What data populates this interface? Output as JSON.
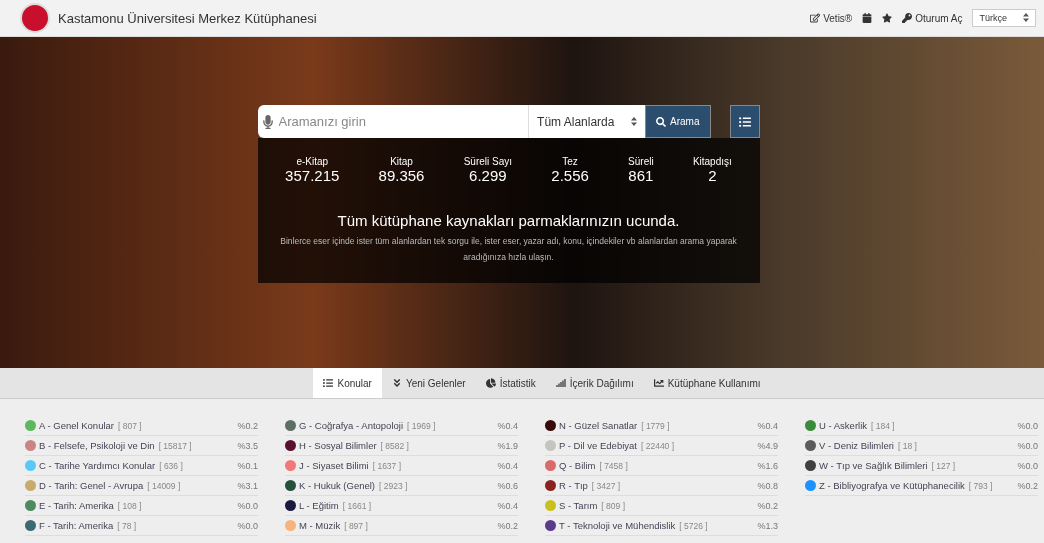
{
  "header": {
    "title": "Kastamonu Üniversitesi Merkez Kütüphanesi",
    "vetis": "Vetis®",
    "login": "Oturum Aç",
    "language": "Türkçe"
  },
  "search": {
    "placeholder": "Aramanızı girin",
    "scope": "Tüm Alanlarda",
    "button": "Arama"
  },
  "stats": [
    {
      "label": "e-Kitap",
      "value": "357.215"
    },
    {
      "label": "Kitap",
      "value": "89.356"
    },
    {
      "label": "Süreli Sayı",
      "value": "6.299"
    },
    {
      "label": "Tez",
      "value": "2.556"
    },
    {
      "label": "Süreli",
      "value": "861"
    },
    {
      "label": "Kitapdışı",
      "value": "2"
    }
  ],
  "headline": "Tüm kütüphane kaynakları parmaklarınızın ucunda.",
  "description": "Binlerce eser içinde ister tüm alanlardan tek sorgu ile, ister eser, yazar adı, konu, içindekiler vb alanlardan arama yaparak aradığınıza hızla ulaşın.",
  "tabs": [
    {
      "kind": "list",
      "label": "Konular",
      "selected": true
    },
    {
      "kind": "chevrons",
      "label": "Yeni Gelenler",
      "selected": false
    },
    {
      "kind": "pie",
      "label": "İstatistik",
      "selected": false
    },
    {
      "kind": "bars",
      "label": "İçerik Dağılımı",
      "selected": false
    },
    {
      "kind": "line",
      "label": "Kütüphane Kullanımı",
      "selected": false
    }
  ],
  "subject_columns": [
    [
      {
        "name": "A - Genel Konular",
        "count": "[ 807 ]",
        "percent": "%0.2",
        "color": "#5cb85c"
      },
      {
        "name": "B - Felsefe, Psikoloji ve Din",
        "count": "[ 15817 ]",
        "percent": "%3.5",
        "color": "#c98585"
      },
      {
        "name": "C - Tarihe Yardımcı Konular",
        "count": "[ 636 ]",
        "percent": "%0.1",
        "color": "#5bc8f5"
      },
      {
        "name": "D - Tarih: Genel - Avrupa",
        "count": "[ 14009 ]",
        "percent": "%3.1",
        "color": "#c8aa6e"
      },
      {
        "name": "E - Tarih: Amerika",
        "count": "[ 108 ]",
        "percent": "%0.0",
        "color": "#4e8a5e"
      },
      {
        "name": "F - Tarih: Amerika",
        "count": "[ 78 ]",
        "percent": "%0.0",
        "color": "#3c6a74"
      }
    ],
    [
      {
        "name": "G - Coğrafya - Antopoloji",
        "count": "[ 1969 ]",
        "percent": "%0.4",
        "color": "#5f6e64"
      },
      {
        "name": "H - Sosyal Bilimler",
        "count": "[ 8582 ]",
        "percent": "%1.9",
        "color": "#5a1030"
      },
      {
        "name": "J - Siyaset Bilimi",
        "count": "[ 1637 ]",
        "percent": "%0.4",
        "color": "#f07878"
      },
      {
        "name": "K - Hukuk (Genel)",
        "count": "[ 2923 ]",
        "percent": "%0.6",
        "color": "#24503c"
      },
      {
        "name": "L - Eğitim",
        "count": "[ 1661 ]",
        "percent": "%0.4",
        "color": "#1a1a40"
      },
      {
        "name": "M - Müzik",
        "count": "[ 897 ]",
        "percent": "%0.2",
        "color": "#f5b37e"
      }
    ],
    [
      {
        "name": "N - Güzel Sanatlar",
        "count": "[ 1779 ]",
        "percent": "%0.4",
        "color": "#3a0a0a"
      },
      {
        "name": "P - Dil ve Edebiyat",
        "count": "[ 22440 ]",
        "percent": "%4.9",
        "color": "#c4c4c0"
      },
      {
        "name": "Q - Bilim",
        "count": "[ 7458 ]",
        "percent": "%1.6",
        "color": "#d86a6a"
      },
      {
        "name": "R - Tıp",
        "count": "[ 3427 ]",
        "percent": "%0.8",
        "color": "#8a2222"
      },
      {
        "name": "S - Tarım",
        "count": "[ 809 ]",
        "percent": "%0.2",
        "color": "#c8c020"
      },
      {
        "name": "T - Teknoloji ve Mühendislik",
        "count": "[ 5726 ]",
        "percent": "%1.3",
        "color": "#5a3a8a"
      }
    ],
    [
      {
        "name": "U - Askerlik",
        "count": "[ 184 ]",
        "percent": "%0.0",
        "color": "#3c8a3c"
      },
      {
        "name": "V - Deniz Bilimleri",
        "count": "[ 18 ]",
        "percent": "%0.0",
        "color": "#5c5c5c"
      },
      {
        "name": "W - Tıp ve Sağlık Bilimleri",
        "count": "[ 127 ]",
        "percent": "%0.0",
        "color": "#404040"
      },
      {
        "name": "Z - Bibliyografya ve Kütüphanecilik",
        "count": "[ 793 ]",
        "percent": "%0.2",
        "color": "#1e90ff"
      }
    ]
  ]
}
